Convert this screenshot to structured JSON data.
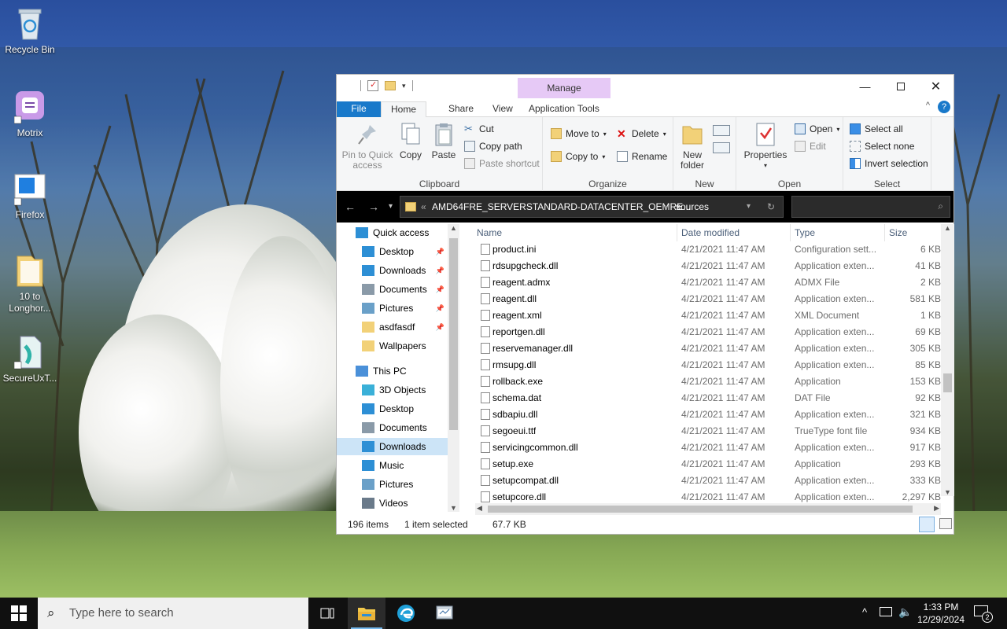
{
  "desktop": {
    "icons": [
      {
        "label": "Recycle Bin"
      },
      {
        "label": "Motrix"
      },
      {
        "label": "Firefox"
      },
      {
        "label": "10 to Longhor..."
      },
      {
        "label": "SecureUxT..."
      }
    ]
  },
  "window": {
    "contextual_tab": "Manage",
    "tabs": [
      "File",
      "Home",
      "Share",
      "View",
      "Application Tools"
    ],
    "ribbon": {
      "clipboard": {
        "pin_to_quick_access": "Pin to Quick access",
        "copy": "Copy",
        "paste": "Paste",
        "cut": "Cut",
        "copy_path": "Copy path",
        "paste_shortcut": "Paste shortcut",
        "label": "Clipboard"
      },
      "organize": {
        "move_to": "Move to",
        "copy_to": "Copy to",
        "delete": "Delete",
        "rename": "Rename",
        "label": "Organize"
      },
      "new": {
        "new_folder": "New folder",
        "label": "New"
      },
      "open": {
        "properties": "Properties",
        "open": "Open",
        "edit": "Edit",
        "label": "Open"
      },
      "select": {
        "select_all": "Select all",
        "select_none": "Select none",
        "invert_selection": "Invert selection",
        "label": "Select"
      }
    },
    "address": {
      "prefix": "«",
      "crumb1": "AMD64FRE_SERVERSTANDARD-DATACENTER_OEMRE...",
      "crumb_sep": "›",
      "crumb2": "sources"
    },
    "nav_pane": {
      "items": [
        {
          "label": "Quick access",
          "icon": "star-icon",
          "pinned": false,
          "selected": false
        },
        {
          "label": "Desktop",
          "icon": "desktop-icon",
          "pinned": true,
          "selected": false
        },
        {
          "label": "Downloads",
          "icon": "download-icon",
          "pinned": true,
          "selected": false
        },
        {
          "label": "Documents",
          "icon": "document-icon",
          "pinned": true,
          "selected": false
        },
        {
          "label": "Pictures",
          "icon": "picture-icon",
          "pinned": true,
          "selected": false
        },
        {
          "label": "asdfasdf",
          "icon": "folder-icon",
          "pinned": true,
          "selected": false
        },
        {
          "label": "Wallpapers",
          "icon": "folder-icon",
          "pinned": false,
          "selected": false
        },
        {
          "label": "This PC",
          "icon": "computer-icon",
          "pinned": false,
          "selected": false
        },
        {
          "label": "3D Objects",
          "icon": "cube-icon",
          "pinned": false,
          "selected": false
        },
        {
          "label": "Desktop",
          "icon": "desktop-icon",
          "pinned": false,
          "selected": false
        },
        {
          "label": "Documents",
          "icon": "document-icon",
          "pinned": false,
          "selected": false
        },
        {
          "label": "Downloads",
          "icon": "download-icon",
          "pinned": false,
          "selected": true
        },
        {
          "label": "Music",
          "icon": "music-icon",
          "pinned": false,
          "selected": false
        },
        {
          "label": "Pictures",
          "icon": "picture-icon",
          "pinned": false,
          "selected": false
        },
        {
          "label": "Videos",
          "icon": "video-icon",
          "pinned": false,
          "selected": false
        }
      ]
    },
    "columns": {
      "name": "Name",
      "date": "Date modified",
      "type": "Type",
      "size": "Size"
    },
    "files": [
      {
        "name": "product.ini",
        "date": "4/21/2021 11:47 AM",
        "type": "Configuration sett...",
        "size": "6 KB"
      },
      {
        "name": "rdsupgcheck.dll",
        "date": "4/21/2021 11:47 AM",
        "type": "Application exten...",
        "size": "41 KB"
      },
      {
        "name": "reagent.admx",
        "date": "4/21/2021 11:47 AM",
        "type": "ADMX File",
        "size": "2 KB"
      },
      {
        "name": "reagent.dll",
        "date": "4/21/2021 11:47 AM",
        "type": "Application exten...",
        "size": "581 KB"
      },
      {
        "name": "reagent.xml",
        "date": "4/21/2021 11:47 AM",
        "type": "XML Document",
        "size": "1 KB"
      },
      {
        "name": "reportgen.dll",
        "date": "4/21/2021 11:47 AM",
        "type": "Application exten...",
        "size": "69 KB"
      },
      {
        "name": "reservemanager.dll",
        "date": "4/21/2021 11:47 AM",
        "type": "Application exten...",
        "size": "305 KB"
      },
      {
        "name": "rmsupg.dll",
        "date": "4/21/2021 11:47 AM",
        "type": "Application exten...",
        "size": "85 KB"
      },
      {
        "name": "rollback.exe",
        "date": "4/21/2021 11:47 AM",
        "type": "Application",
        "size": "153 KB"
      },
      {
        "name": "schema.dat",
        "date": "4/21/2021 11:47 AM",
        "type": "DAT File",
        "size": "92 KB"
      },
      {
        "name": "sdbapiu.dll",
        "date": "4/21/2021 11:47 AM",
        "type": "Application exten...",
        "size": "321 KB"
      },
      {
        "name": "segoeui.ttf",
        "date": "4/21/2021 11:47 AM",
        "type": "TrueType font file",
        "size": "934 KB"
      },
      {
        "name": "servicingcommon.dll",
        "date": "4/21/2021 11:47 AM",
        "type": "Application exten...",
        "size": "917 KB"
      },
      {
        "name": "setup.exe",
        "date": "4/21/2021 11:47 AM",
        "type": "Application",
        "size": "293 KB"
      },
      {
        "name": "setupcompat.dll",
        "date": "4/21/2021 11:47 AM",
        "type": "Application exten...",
        "size": "333 KB"
      },
      {
        "name": "setupcore.dll",
        "date": "4/21/2021 11:47 AM",
        "type": "Application exten...",
        "size": "2,297 KB"
      }
    ],
    "status": {
      "items": "196 items",
      "selected": "1 item selected",
      "size": "67.7 KB"
    }
  },
  "taskbar": {
    "search_placeholder": "Type here to search",
    "time": "1:33 PM",
    "date": "12/29/2024",
    "notification_count": "2"
  },
  "colors": {
    "accent": "#1979ca",
    "manage_tab": "#e6c9f6",
    "selection": "#cce4f7"
  }
}
